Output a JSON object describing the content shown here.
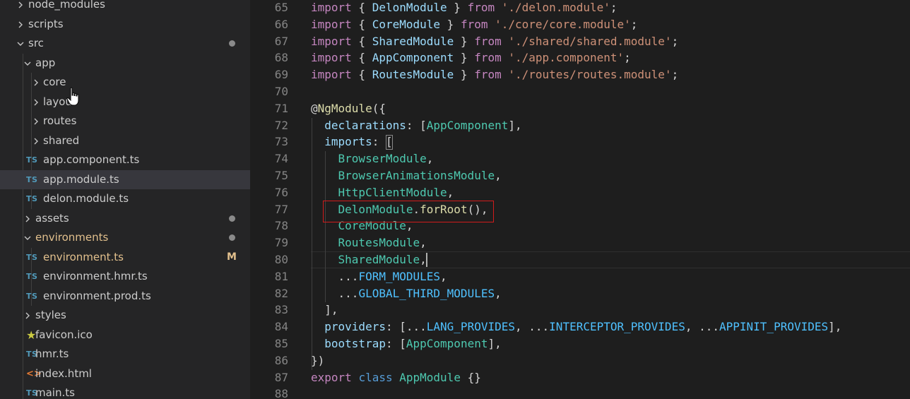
{
  "explorer": {
    "items": [
      {
        "label": "node_modules",
        "kind": "folder",
        "open": false,
        "depth": 0
      },
      {
        "label": "scripts",
        "kind": "folder",
        "open": false,
        "depth": 0
      },
      {
        "label": "src",
        "kind": "folder",
        "open": true,
        "depth": 0,
        "dot": true
      },
      {
        "label": "app",
        "kind": "folder",
        "open": true,
        "depth": 1
      },
      {
        "label": "core",
        "kind": "folder",
        "open": false,
        "depth": 2
      },
      {
        "label": "layout",
        "kind": "folder",
        "open": false,
        "depth": 2
      },
      {
        "label": "routes",
        "kind": "folder",
        "open": false,
        "depth": 2
      },
      {
        "label": "shared",
        "kind": "folder",
        "open": false,
        "depth": 2
      },
      {
        "label": "app.component.ts",
        "kind": "ts",
        "depth": 2
      },
      {
        "label": "app.module.ts",
        "kind": "ts",
        "depth": 2,
        "selected": true
      },
      {
        "label": "delon.module.ts",
        "kind": "ts",
        "depth": 2
      },
      {
        "label": "assets",
        "kind": "folder",
        "open": false,
        "depth": 1,
        "dot": true
      },
      {
        "label": "environments",
        "kind": "folder",
        "open": true,
        "depth": 1,
        "dot": true,
        "modified": true
      },
      {
        "label": "environment.ts",
        "kind": "ts",
        "depth": 2,
        "badge": "M",
        "modified": true
      },
      {
        "label": "environment.hmr.ts",
        "kind": "ts",
        "depth": 2
      },
      {
        "label": "environment.prod.ts",
        "kind": "ts",
        "depth": 2
      },
      {
        "label": "styles",
        "kind": "folder",
        "open": false,
        "depth": 1
      },
      {
        "label": "favicon.ico",
        "kind": "star",
        "depth": 1
      },
      {
        "label": "hmr.ts",
        "kind": "ts",
        "depth": 1
      },
      {
        "label": "index.html",
        "kind": "html",
        "depth": 1
      },
      {
        "label": "main.ts",
        "kind": "ts",
        "depth": 1
      }
    ],
    "ts_icon_text": "TS",
    "html_icon_text": "<>",
    "star_icon_text": "★"
  },
  "editor": {
    "first_line": 65,
    "current_line": 80,
    "highlight_line": 77,
    "lines": [
      [
        [
          "import",
          "kw"
        ],
        [
          " { ",
          "pn"
        ],
        [
          "DelonModule",
          "pr"
        ],
        [
          " } ",
          "pn"
        ],
        [
          "from",
          "kw"
        ],
        [
          " ",
          "pn"
        ],
        [
          "'./delon.module'",
          "str"
        ],
        [
          ";",
          "pn"
        ]
      ],
      [
        [
          "import",
          "kw"
        ],
        [
          " { ",
          "pn"
        ],
        [
          "CoreModule",
          "pr"
        ],
        [
          " } ",
          "pn"
        ],
        [
          "from",
          "kw"
        ],
        [
          " ",
          "pn"
        ],
        [
          "'./core/core.module'",
          "str"
        ],
        [
          ";",
          "pn"
        ]
      ],
      [
        [
          "import",
          "kw"
        ],
        [
          " { ",
          "pn"
        ],
        [
          "SharedModule",
          "pr"
        ],
        [
          " } ",
          "pn"
        ],
        [
          "from",
          "kw"
        ],
        [
          " ",
          "pn"
        ],
        [
          "'./shared/shared.module'",
          "str"
        ],
        [
          ";",
          "pn"
        ]
      ],
      [
        [
          "import",
          "kw"
        ],
        [
          " { ",
          "pn"
        ],
        [
          "AppComponent",
          "pr"
        ],
        [
          " } ",
          "pn"
        ],
        [
          "from",
          "kw"
        ],
        [
          " ",
          "pn"
        ],
        [
          "'./app.component'",
          "str"
        ],
        [
          ";",
          "pn"
        ]
      ],
      [
        [
          "import",
          "kw"
        ],
        [
          " { ",
          "pn"
        ],
        [
          "RoutesModule",
          "pr"
        ],
        [
          " } ",
          "pn"
        ],
        [
          "from",
          "kw"
        ],
        [
          " ",
          "pn"
        ],
        [
          "'./routes/routes.module'",
          "str"
        ],
        [
          ";",
          "pn"
        ]
      ],
      [],
      [
        [
          "@",
          "pn"
        ],
        [
          "NgModule",
          "fn"
        ],
        [
          "({",
          "pn"
        ]
      ],
      [
        [
          "  ",
          "pn"
        ],
        [
          "declarations",
          "pr"
        ],
        [
          ": [",
          "pn"
        ],
        [
          "AppComponent",
          "ty"
        ],
        [
          "],",
          "pn"
        ]
      ],
      [
        [
          "  ",
          "pn"
        ],
        [
          "imports",
          "pr"
        ],
        [
          ": [",
          "pn"
        ]
      ],
      [
        [
          "    ",
          "pn"
        ],
        [
          "BrowserModule",
          "ty"
        ],
        [
          ",",
          "pn"
        ]
      ],
      [
        [
          "    ",
          "pn"
        ],
        [
          "BrowserAnimationsModule",
          "ty"
        ],
        [
          ",",
          "pn"
        ]
      ],
      [
        [
          "    ",
          "pn"
        ],
        [
          "HttpClientModule",
          "ty"
        ],
        [
          ",",
          "pn"
        ]
      ],
      [
        [
          "    ",
          "pn"
        ],
        [
          "DelonModule",
          "ty"
        ],
        [
          ".",
          "pn"
        ],
        [
          "forRoot",
          "fn"
        ],
        [
          "(),",
          "pn"
        ]
      ],
      [
        [
          "    ",
          "pn"
        ],
        [
          "CoreModule",
          "ty"
        ],
        [
          ",",
          "pn"
        ]
      ],
      [
        [
          "    ",
          "pn"
        ],
        [
          "RoutesModule",
          "ty"
        ],
        [
          ",",
          "pn"
        ]
      ],
      [
        [
          "    ",
          "pn"
        ],
        [
          "SharedModule",
          "ty"
        ],
        [
          ",",
          "pn"
        ]
      ],
      [
        [
          "    ...",
          "pn"
        ],
        [
          "FORM_MODULES",
          "cst"
        ],
        [
          ",",
          "pn"
        ]
      ],
      [
        [
          "    ...",
          "pn"
        ],
        [
          "GLOBAL_THIRD_MODULES",
          "cst"
        ],
        [
          ",",
          "pn"
        ]
      ],
      [
        [
          "  ],",
          "pn"
        ]
      ],
      [
        [
          "  ",
          "pn"
        ],
        [
          "providers",
          "pr"
        ],
        [
          ": [...",
          "pn"
        ],
        [
          "LANG_PROVIDES",
          "cst"
        ],
        [
          ", ...",
          "pn"
        ],
        [
          "INTERCEPTOR_PROVIDES",
          "cst"
        ],
        [
          ", ...",
          "pn"
        ],
        [
          "APPINIT_PROVIDES",
          "cst"
        ],
        [
          "],",
          "pn"
        ]
      ],
      [
        [
          "  ",
          "pn"
        ],
        [
          "bootstrap",
          "pr"
        ],
        [
          ": [",
          "pn"
        ],
        [
          "AppComponent",
          "ty"
        ],
        [
          "],",
          "pn"
        ]
      ],
      [
        [
          "})",
          "pn"
        ]
      ],
      [
        [
          "export",
          "kw"
        ],
        [
          " ",
          "pn"
        ],
        [
          "class",
          "kb"
        ],
        [
          " ",
          "pn"
        ],
        [
          "AppModule",
          "ty"
        ],
        [
          " {}",
          "pn"
        ]
      ],
      []
    ]
  }
}
